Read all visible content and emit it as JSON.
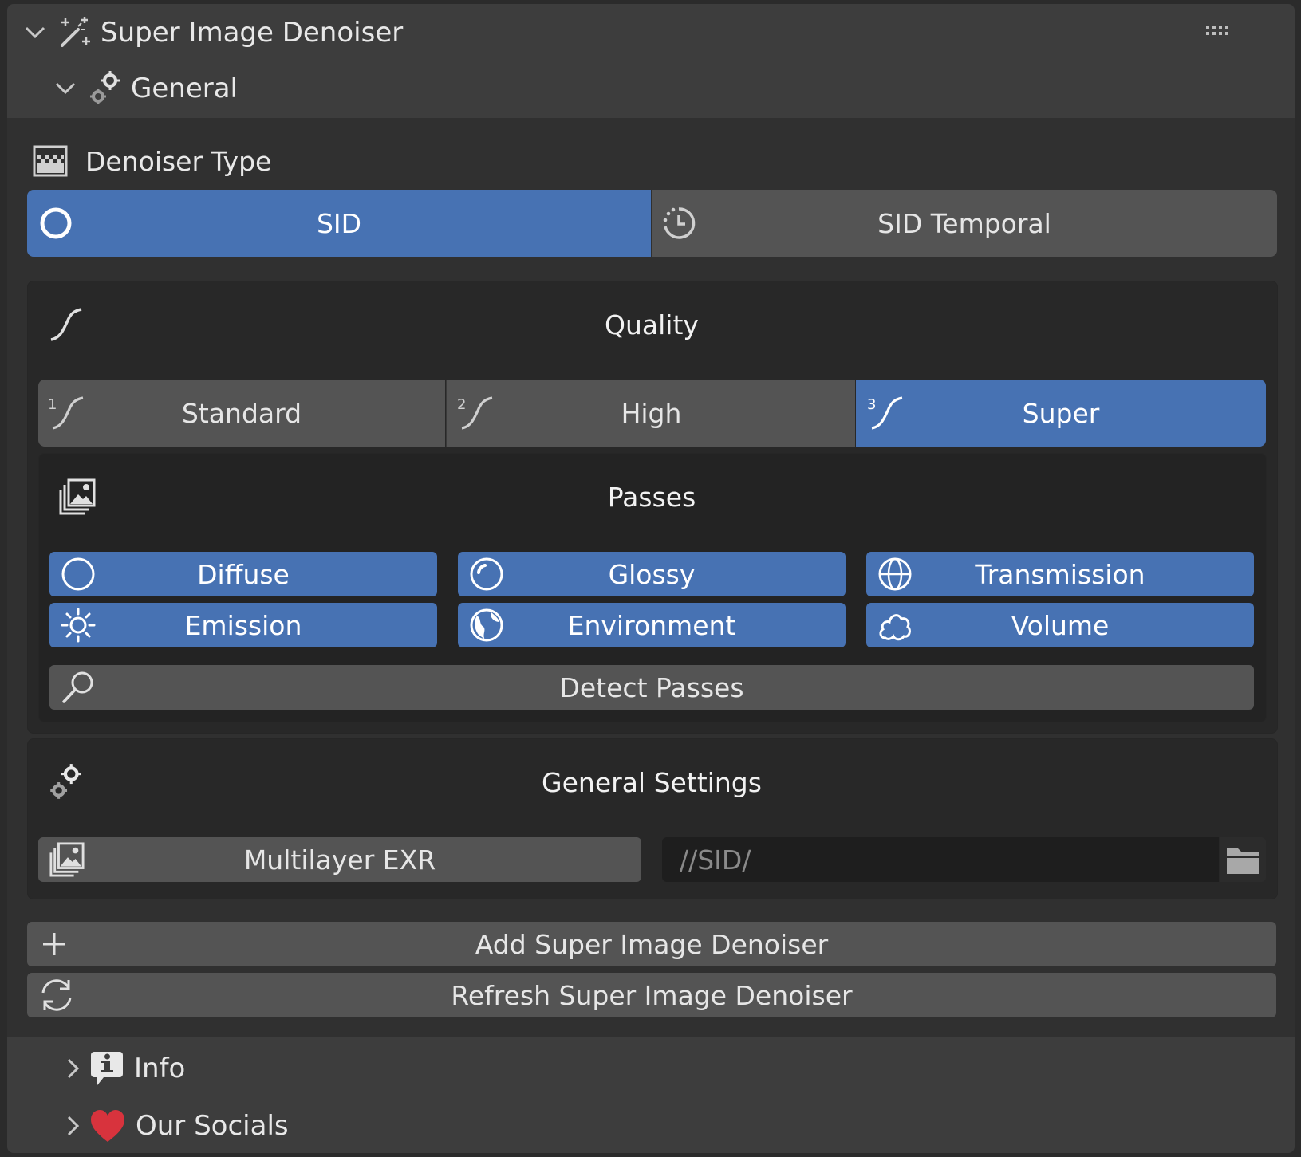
{
  "panel": {
    "title": "Super Image Denoiser",
    "subpanel_title": "General"
  },
  "denoiser_type": {
    "label": "Denoiser Type",
    "options": [
      {
        "label": "SID",
        "selected": true
      },
      {
        "label": "SID Temporal",
        "selected": false
      }
    ]
  },
  "quality": {
    "title": "Quality",
    "options": [
      {
        "num": "1",
        "label": "Standard",
        "selected": false
      },
      {
        "num": "2",
        "label": "High",
        "selected": false
      },
      {
        "num": "3",
        "label": "Super",
        "selected": true
      }
    ]
  },
  "passes": {
    "title": "Passes",
    "toggles": [
      {
        "label": "Diffuse",
        "icon": "circle-icon",
        "on": true
      },
      {
        "label": "Glossy",
        "icon": "glossy-sphere-icon",
        "on": true
      },
      {
        "label": "Transmission",
        "icon": "transmission-sphere-icon",
        "on": true
      },
      {
        "label": "Emission",
        "icon": "sun-icon",
        "on": true
      },
      {
        "label": "Environment",
        "icon": "world-icon",
        "on": true
      },
      {
        "label": "Volume",
        "icon": "cloud-icon",
        "on": true
      }
    ],
    "detect_label": "Detect Passes"
  },
  "general_settings": {
    "title": "General Settings",
    "format_label": "Multilayer EXR",
    "path_value": "//SID/"
  },
  "actions": {
    "add_label": "Add Super Image Denoiser",
    "refresh_label": "Refresh Super Image Denoiser"
  },
  "collapsed_panels": [
    {
      "label": "Info",
      "icon": "info-icon"
    },
    {
      "label": "Our Socials",
      "icon": "heart-icon"
    }
  ],
  "colors": {
    "accent_blue": "#4772b3",
    "button_gray": "#545454",
    "panel_bg": "#3d3d3d",
    "box_bg": "#282828",
    "heart_red": "#d8333d"
  }
}
